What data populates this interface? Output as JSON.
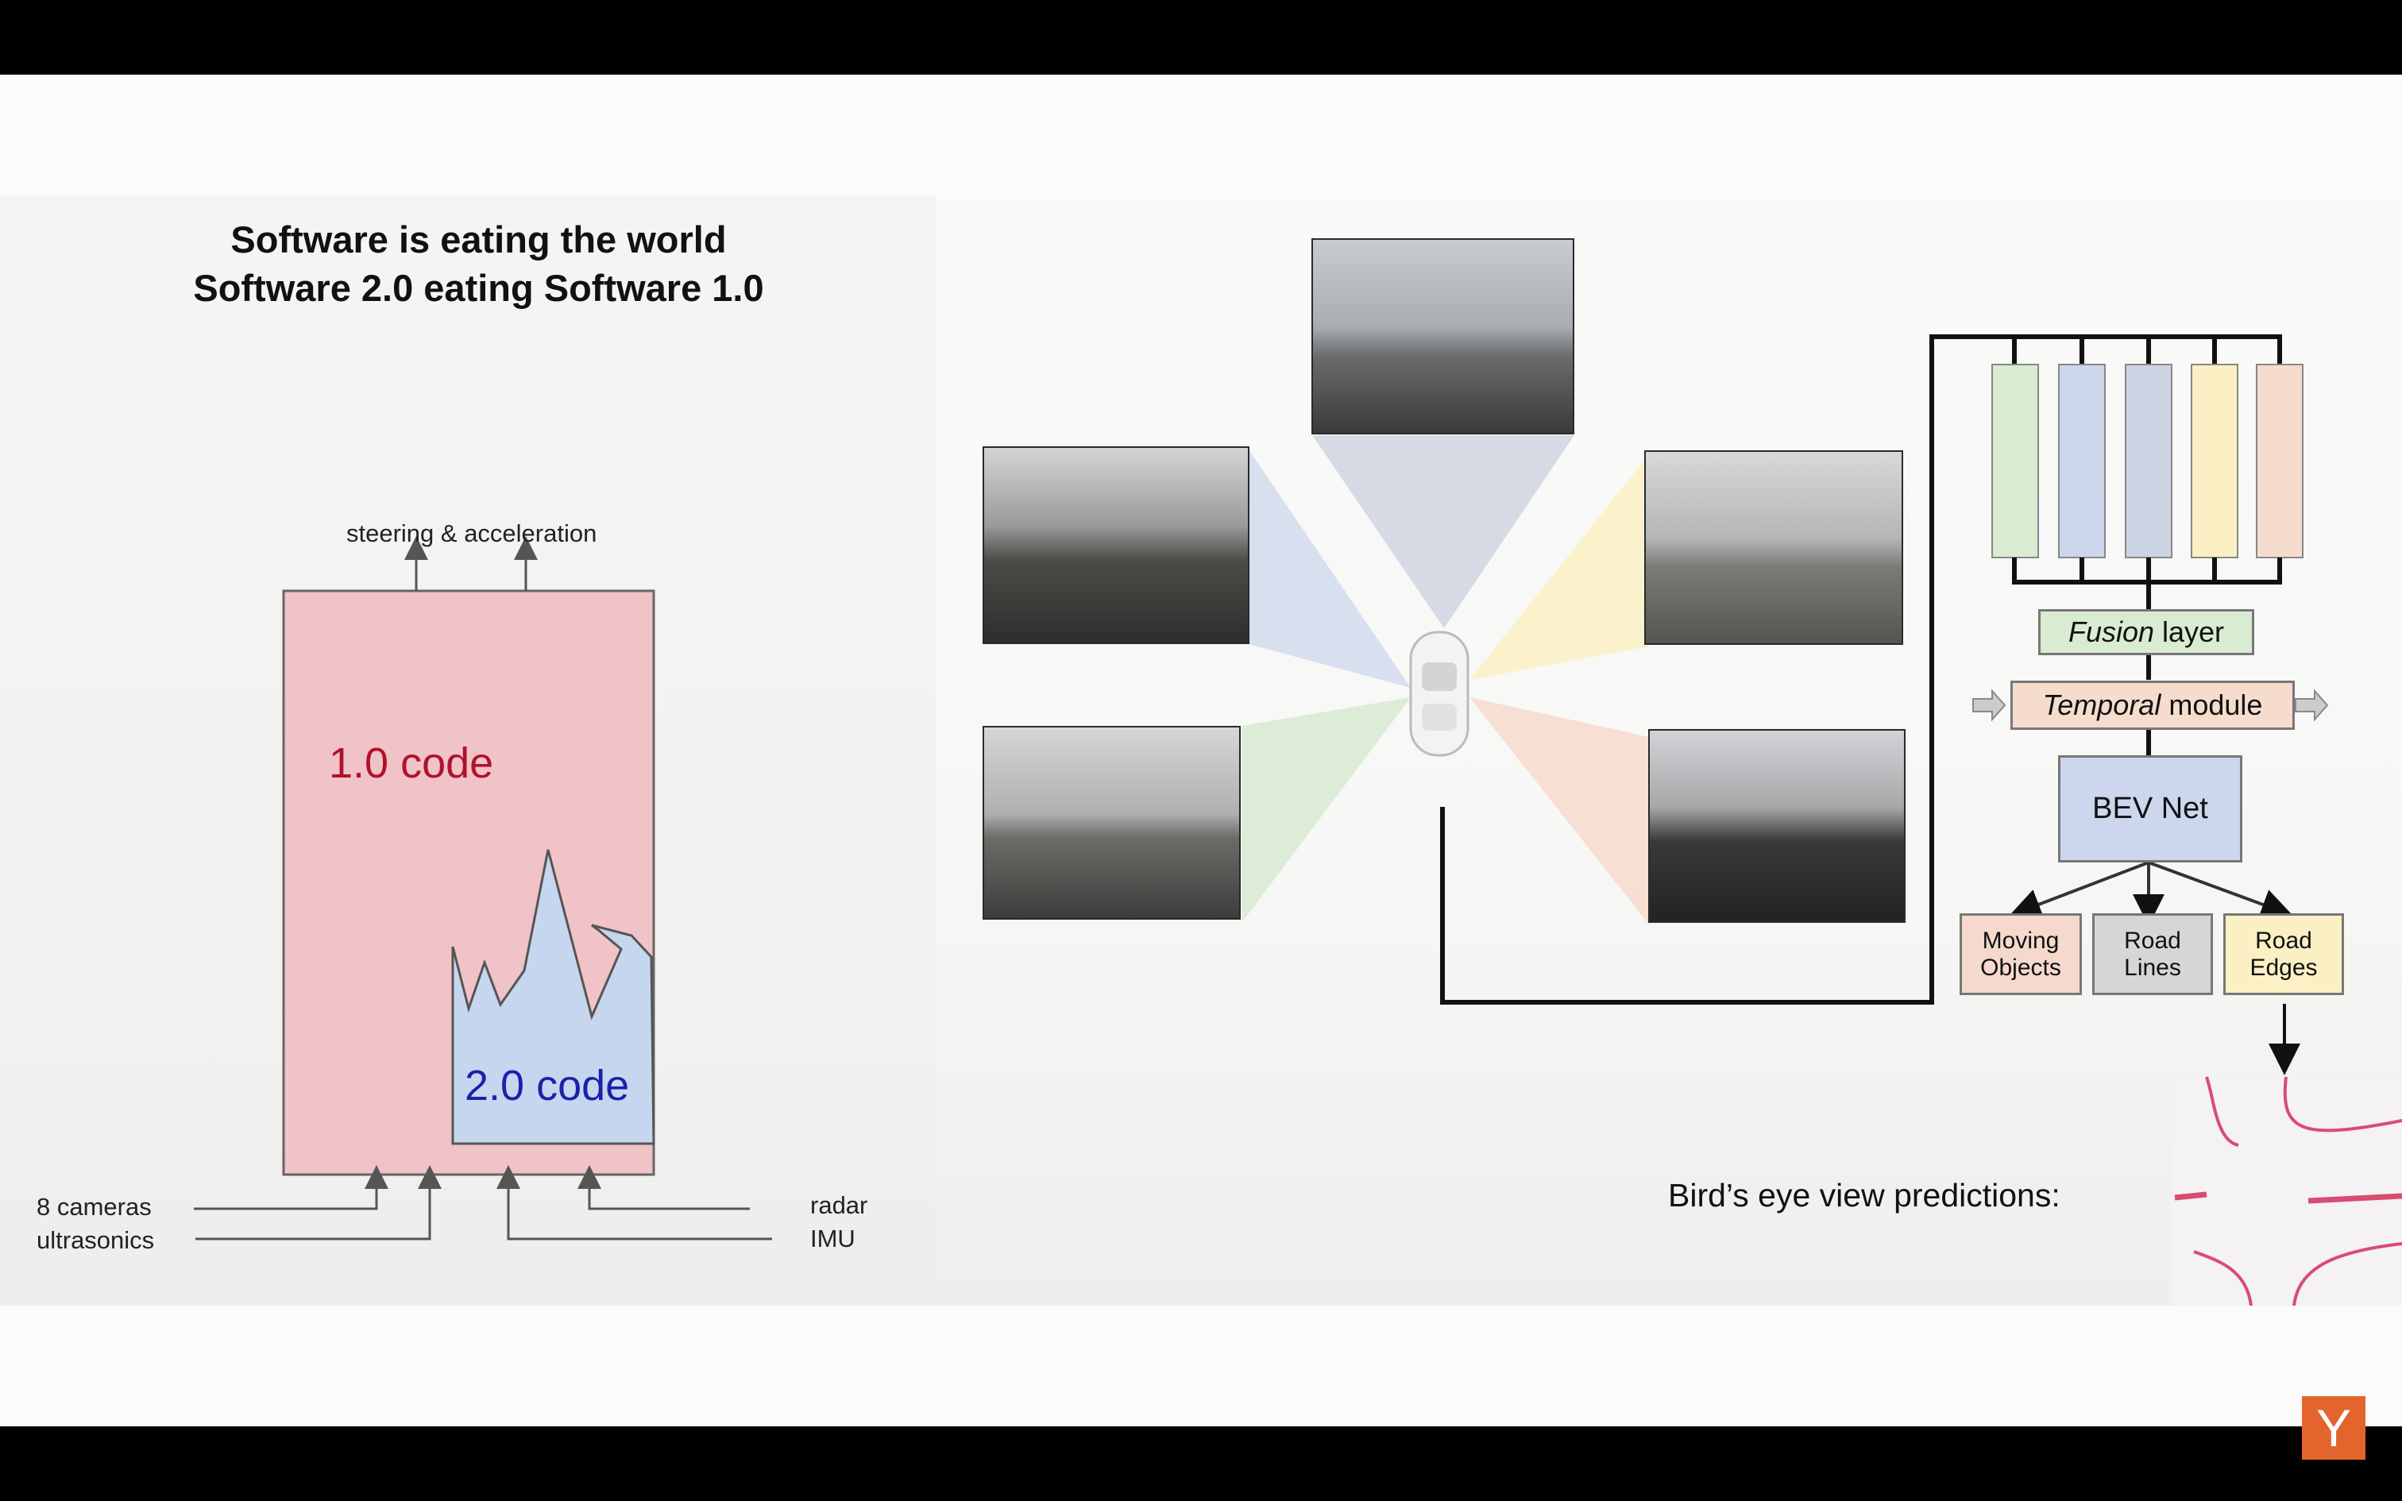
{
  "slide": {
    "title_line1": "Software is eating the world",
    "title_line2": "Software 2.0 eating Software 1.0"
  },
  "left_diagram": {
    "output_label": "steering & acceleration",
    "code_1_label": "1.0 code",
    "code_2_label": "2.0 code",
    "inputs_left": [
      "8 cameras",
      "ultrasonics"
    ],
    "inputs_right": [
      "radar",
      "IMU"
    ],
    "colors": {
      "code_1": "#f0c3c8",
      "code_1_text": "#b0122a",
      "code_2": "#c7d6ef",
      "code_2_text": "#1a22a8"
    }
  },
  "right_diagram": {
    "fusion_label_italic": "Fusion",
    "fusion_label_rest": " layer",
    "temporal_label_italic": "Temporal",
    "temporal_label_rest": " module",
    "bev_label": "BEV Net",
    "outputs": [
      {
        "line1": "Moving",
        "line2": "Objects",
        "color": "#f6d9cd"
      },
      {
        "line1": "Road",
        "line2": "Lines",
        "color": "#d6d6d6"
      },
      {
        "line1": "Road",
        "line2": "Edges",
        "color": "#fbf0c4"
      }
    ],
    "feature_columns_colors": [
      "#d9ecd2",
      "#ccd6ec",
      "#cdd4e4",
      "#fbf0c4",
      "#f6dccd"
    ],
    "bev_caption": "Bird’s eye view predictions:"
  },
  "branding": {
    "logo_letter": "Y",
    "logo_color": "#e3652d"
  }
}
